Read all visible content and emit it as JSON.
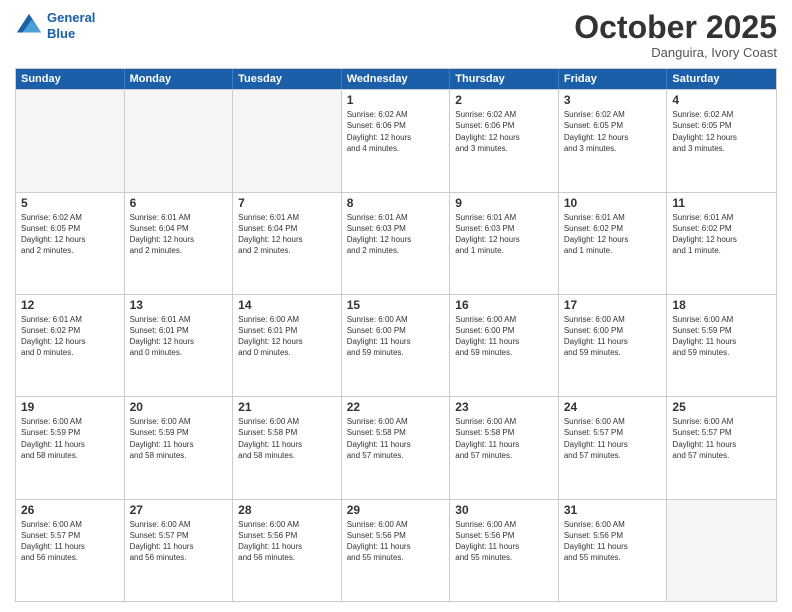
{
  "header": {
    "logo_line1": "General",
    "logo_line2": "Blue",
    "month": "October 2025",
    "location": "Danguira, Ivory Coast"
  },
  "weekdays": [
    "Sunday",
    "Monday",
    "Tuesday",
    "Wednesday",
    "Thursday",
    "Friday",
    "Saturday"
  ],
  "rows": [
    [
      {
        "day": "",
        "text": "",
        "empty": true
      },
      {
        "day": "",
        "text": "",
        "empty": true
      },
      {
        "day": "",
        "text": "",
        "empty": true
      },
      {
        "day": "1",
        "text": "Sunrise: 6:02 AM\nSunset: 6:06 PM\nDaylight: 12 hours\nand 4 minutes.",
        "empty": false
      },
      {
        "day": "2",
        "text": "Sunrise: 6:02 AM\nSunset: 6:06 PM\nDaylight: 12 hours\nand 3 minutes.",
        "empty": false
      },
      {
        "day": "3",
        "text": "Sunrise: 6:02 AM\nSunset: 6:05 PM\nDaylight: 12 hours\nand 3 minutes.",
        "empty": false
      },
      {
        "day": "4",
        "text": "Sunrise: 6:02 AM\nSunset: 6:05 PM\nDaylight: 12 hours\nand 3 minutes.",
        "empty": false
      }
    ],
    [
      {
        "day": "5",
        "text": "Sunrise: 6:02 AM\nSunset: 6:05 PM\nDaylight: 12 hours\nand 2 minutes.",
        "empty": false
      },
      {
        "day": "6",
        "text": "Sunrise: 6:01 AM\nSunset: 6:04 PM\nDaylight: 12 hours\nand 2 minutes.",
        "empty": false
      },
      {
        "day": "7",
        "text": "Sunrise: 6:01 AM\nSunset: 6:04 PM\nDaylight: 12 hours\nand 2 minutes.",
        "empty": false
      },
      {
        "day": "8",
        "text": "Sunrise: 6:01 AM\nSunset: 6:03 PM\nDaylight: 12 hours\nand 2 minutes.",
        "empty": false
      },
      {
        "day": "9",
        "text": "Sunrise: 6:01 AM\nSunset: 6:03 PM\nDaylight: 12 hours\nand 1 minute.",
        "empty": false
      },
      {
        "day": "10",
        "text": "Sunrise: 6:01 AM\nSunset: 6:02 PM\nDaylight: 12 hours\nand 1 minute.",
        "empty": false
      },
      {
        "day": "11",
        "text": "Sunrise: 6:01 AM\nSunset: 6:02 PM\nDaylight: 12 hours\nand 1 minute.",
        "empty": false
      }
    ],
    [
      {
        "day": "12",
        "text": "Sunrise: 6:01 AM\nSunset: 6:02 PM\nDaylight: 12 hours\nand 0 minutes.",
        "empty": false
      },
      {
        "day": "13",
        "text": "Sunrise: 6:01 AM\nSunset: 6:01 PM\nDaylight: 12 hours\nand 0 minutes.",
        "empty": false
      },
      {
        "day": "14",
        "text": "Sunrise: 6:00 AM\nSunset: 6:01 PM\nDaylight: 12 hours\nand 0 minutes.",
        "empty": false
      },
      {
        "day": "15",
        "text": "Sunrise: 6:00 AM\nSunset: 6:00 PM\nDaylight: 11 hours\nand 59 minutes.",
        "empty": false
      },
      {
        "day": "16",
        "text": "Sunrise: 6:00 AM\nSunset: 6:00 PM\nDaylight: 11 hours\nand 59 minutes.",
        "empty": false
      },
      {
        "day": "17",
        "text": "Sunrise: 6:00 AM\nSunset: 6:00 PM\nDaylight: 11 hours\nand 59 minutes.",
        "empty": false
      },
      {
        "day": "18",
        "text": "Sunrise: 6:00 AM\nSunset: 5:59 PM\nDaylight: 11 hours\nand 59 minutes.",
        "empty": false
      }
    ],
    [
      {
        "day": "19",
        "text": "Sunrise: 6:00 AM\nSunset: 5:59 PM\nDaylight: 11 hours\nand 58 minutes.",
        "empty": false
      },
      {
        "day": "20",
        "text": "Sunrise: 6:00 AM\nSunset: 5:59 PM\nDaylight: 11 hours\nand 58 minutes.",
        "empty": false
      },
      {
        "day": "21",
        "text": "Sunrise: 6:00 AM\nSunset: 5:58 PM\nDaylight: 11 hours\nand 58 minutes.",
        "empty": false
      },
      {
        "day": "22",
        "text": "Sunrise: 6:00 AM\nSunset: 5:58 PM\nDaylight: 11 hours\nand 57 minutes.",
        "empty": false
      },
      {
        "day": "23",
        "text": "Sunrise: 6:00 AM\nSunset: 5:58 PM\nDaylight: 11 hours\nand 57 minutes.",
        "empty": false
      },
      {
        "day": "24",
        "text": "Sunrise: 6:00 AM\nSunset: 5:57 PM\nDaylight: 11 hours\nand 57 minutes.",
        "empty": false
      },
      {
        "day": "25",
        "text": "Sunrise: 6:00 AM\nSunset: 5:57 PM\nDaylight: 11 hours\nand 57 minutes.",
        "empty": false
      }
    ],
    [
      {
        "day": "26",
        "text": "Sunrise: 6:00 AM\nSunset: 5:57 PM\nDaylight: 11 hours\nand 56 minutes.",
        "empty": false
      },
      {
        "day": "27",
        "text": "Sunrise: 6:00 AM\nSunset: 5:57 PM\nDaylight: 11 hours\nand 56 minutes.",
        "empty": false
      },
      {
        "day": "28",
        "text": "Sunrise: 6:00 AM\nSunset: 5:56 PM\nDaylight: 11 hours\nand 56 minutes.",
        "empty": false
      },
      {
        "day": "29",
        "text": "Sunrise: 6:00 AM\nSunset: 5:56 PM\nDaylight: 11 hours\nand 55 minutes.",
        "empty": false
      },
      {
        "day": "30",
        "text": "Sunrise: 6:00 AM\nSunset: 5:56 PM\nDaylight: 11 hours\nand 55 minutes.",
        "empty": false
      },
      {
        "day": "31",
        "text": "Sunrise: 6:00 AM\nSunset: 5:56 PM\nDaylight: 11 hours\nand 55 minutes.",
        "empty": false
      },
      {
        "day": "",
        "text": "",
        "empty": true
      }
    ]
  ]
}
